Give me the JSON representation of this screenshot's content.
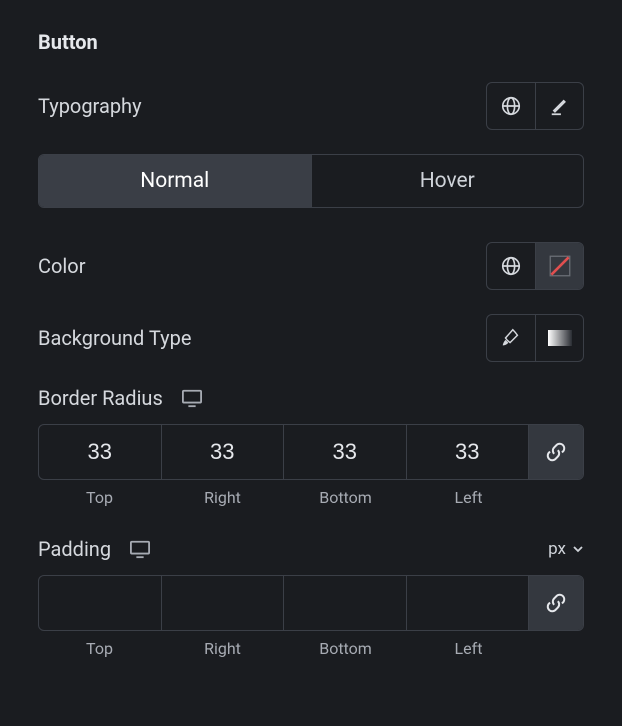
{
  "section_title": "Button",
  "typography": {
    "label": "Typography"
  },
  "tabs": {
    "normal": "Normal",
    "hover": "Hover",
    "active": "normal"
  },
  "color": {
    "label": "Color"
  },
  "background_type": {
    "label": "Background Type"
  },
  "border_radius": {
    "label": "Border Radius",
    "top": "33",
    "right": "33",
    "bottom": "33",
    "left": "33",
    "side_labels": {
      "top": "Top",
      "right": "Right",
      "bottom": "Bottom",
      "left": "Left"
    }
  },
  "padding": {
    "label": "Padding",
    "unit": "px",
    "top": "",
    "right": "",
    "bottom": "",
    "left": "",
    "side_labels": {
      "top": "Top",
      "right": "Right",
      "bottom": "Bottom",
      "left": "Left"
    }
  }
}
